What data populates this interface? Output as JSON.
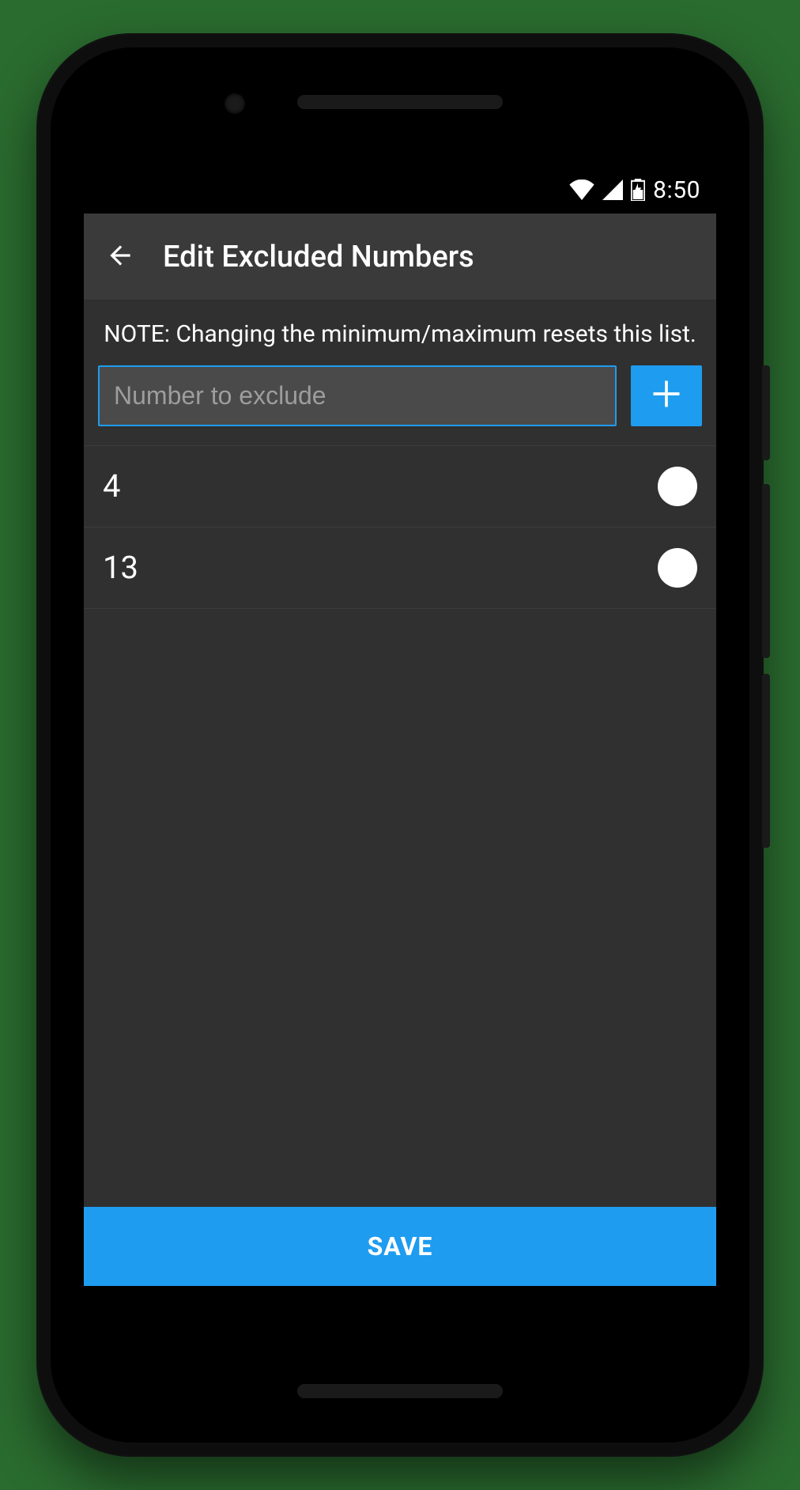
{
  "status": {
    "time": "8:50"
  },
  "appbar": {
    "title": "Edit Excluded Numbers"
  },
  "note": "NOTE: Changing the minimum/maximum resets this list.",
  "input": {
    "placeholder": "Number to exclude",
    "value": ""
  },
  "list": [
    {
      "value": "4"
    },
    {
      "value": "13"
    }
  ],
  "save_label": "SAVE",
  "colors": {
    "accent": "#1e9cf0"
  }
}
